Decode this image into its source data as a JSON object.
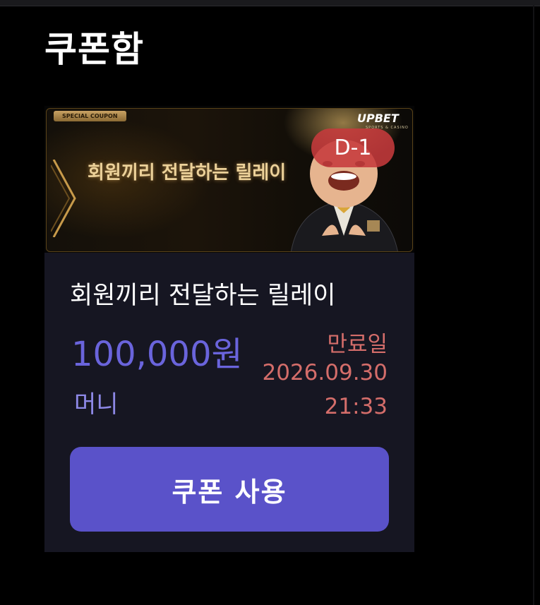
{
  "page": {
    "title": "쿠폰함"
  },
  "coupon": {
    "banner": {
      "tag": "SPECIAL COUPON",
      "headline": "회원끼리 전달하는 릴레이",
      "brand": "UPBET",
      "brand_sub": "SPORTS & CASINO"
    },
    "dday": "D-1",
    "name": "회원끼리 전달하는 릴레이",
    "amount": "100,000원",
    "type": "머니",
    "expiry_label": "만료일",
    "expiry_date": "2026.09.30",
    "expiry_time": "21:33",
    "use_button_label": "쿠폰 사용"
  },
  "colors": {
    "background": "#000000",
    "card": "#161622",
    "accent": "#5a52c9",
    "amount": "#6a64dc",
    "expiry": "#d46d6a",
    "badge": "#c63a3c"
  }
}
